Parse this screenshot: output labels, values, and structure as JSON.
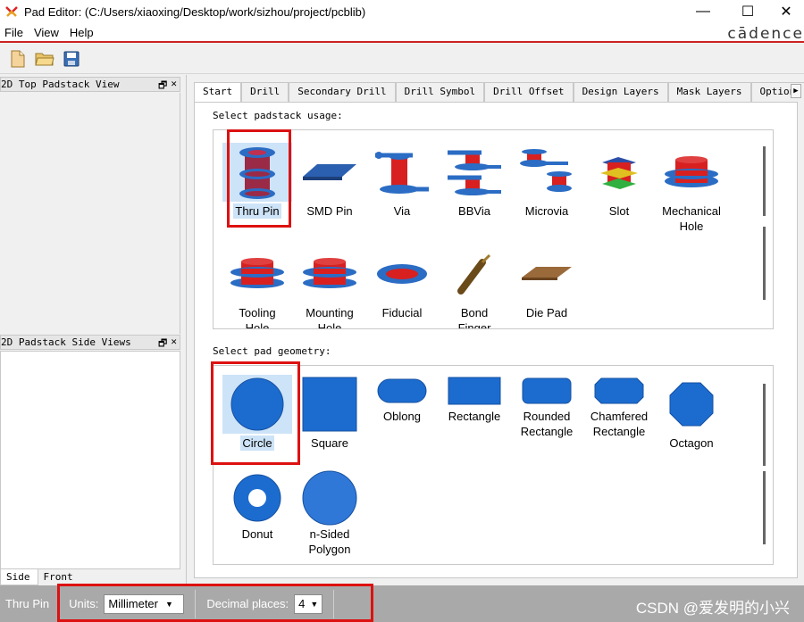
{
  "window": {
    "title": "Pad Editor:  (C:/Users/xiaoxing/Desktop/work/sizhou/project/pcblib)",
    "minimize_glyph": "—",
    "maximize_glyph": "☐",
    "close_glyph": "✕"
  },
  "menu": {
    "items": [
      "File",
      "View",
      "Help"
    ],
    "logo": "cādence"
  },
  "toolbar": {
    "icons": [
      "new-file-icon",
      "open-folder-icon",
      "save-icon"
    ]
  },
  "left_panels": {
    "top_view_title": "2D Top Padstack View",
    "side_view_title": "2D Padstack Side Views",
    "restore_glyph": "🗗",
    "close_glyph": "✕",
    "tabs": [
      "Side",
      "Front"
    ],
    "active_tab": "Side"
  },
  "tabs": {
    "items": [
      "Start",
      "Drill",
      "Secondary Drill",
      "Drill Symbol",
      "Drill Offset",
      "Design Layers",
      "Mask Layers",
      "Options"
    ],
    "active": "Start",
    "scroll_glyph": "▶"
  },
  "usage": {
    "label": "Select padstack usage:",
    "items": [
      {
        "l1": "Thru Pin",
        "l2": "",
        "selected": true
      },
      {
        "l1": "SMD Pin",
        "l2": ""
      },
      {
        "l1": "Via",
        "l2": ""
      },
      {
        "l1": "BBVia",
        "l2": ""
      },
      {
        "l1": "Microvia",
        "l2": ""
      },
      {
        "l1": "Slot",
        "l2": ""
      },
      {
        "l1": "Mechanical",
        "l2": "Hole"
      },
      {
        "l1": "Tooling",
        "l2": "Hole"
      },
      {
        "l1": "Mounting",
        "l2": "Hole"
      },
      {
        "l1": "Fiducial",
        "l2": ""
      },
      {
        "l1": "Bond",
        "l2": "Finger"
      },
      {
        "l1": "Die Pad",
        "l2": ""
      }
    ]
  },
  "geometry": {
    "label": "Select pad geometry:",
    "items": [
      {
        "l1": "Circle",
        "l2": "",
        "selected": true
      },
      {
        "l1": "Square",
        "l2": ""
      },
      {
        "l1": "Oblong",
        "l2": ""
      },
      {
        "l1": "Rectangle",
        "l2": ""
      },
      {
        "l1": "Rounded",
        "l2": "Rectangle"
      },
      {
        "l1": "Chamfered",
        "l2": "Rectangle"
      },
      {
        "l1": "Octagon",
        "l2": ""
      },
      {
        "l1": "Donut",
        "l2": ""
      },
      {
        "l1": "n-Sided",
        "l2": "Polygon"
      }
    ]
  },
  "statusbar": {
    "usage": "Thru Pin",
    "units_label": "Units:",
    "units_value": "Millimeter",
    "decimal_label": "Decimal places:",
    "decimal_value": "4",
    "dropdown_glyph": "▼",
    "watermark": "CSDN @爱发明的小兴"
  },
  "colors": {
    "accent_red": "#cc2222",
    "pad_blue": "#1f6fd1",
    "drill_red": "#d82020",
    "selection": "#cde3f7"
  }
}
